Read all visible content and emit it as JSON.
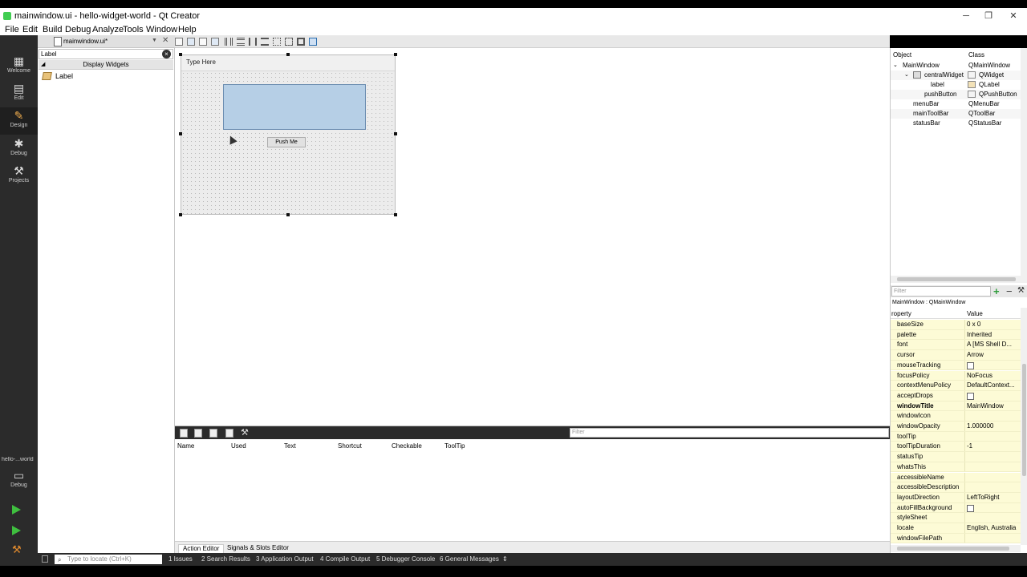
{
  "window": {
    "title": "mainwindow.ui - hello-widget-world - Qt Creator",
    "minimize": "─",
    "maximize": "❐",
    "close": "✕"
  },
  "menu": [
    "File",
    "Edit",
    "Build",
    "Debug",
    "Analyze",
    "Tools",
    "Window",
    "Help"
  ],
  "modes": [
    {
      "label": "Welcome",
      "icon": "grid-icon"
    },
    {
      "label": "Edit",
      "icon": "document-icon"
    },
    {
      "label": "Design",
      "icon": "pencil-icon"
    },
    {
      "label": "Debug",
      "icon": "bug-icon"
    },
    {
      "label": "Projects",
      "icon": "wrench-icon"
    }
  ],
  "kit": {
    "project": "hello-...world",
    "build": "Debug"
  },
  "editor_tab": {
    "name": "mainwindow.ui*",
    "close": "✕"
  },
  "widgetbox": {
    "filter_value": "Label",
    "category": "Display Widgets",
    "item": "Label"
  },
  "form": {
    "menu_placeholder": "Type Here",
    "button_text": "Push Me"
  },
  "object_inspector": {
    "headers": {
      "object": "Object",
      "class": "Class"
    },
    "rows": [
      {
        "name": "MainWindow",
        "class": "QMainWindow"
      },
      {
        "name": "centralWidget",
        "class": "QWidget"
      },
      {
        "name": "label",
        "class": "QLabel"
      },
      {
        "name": "pushButton",
        "class": "QPushButton"
      },
      {
        "name": "menuBar",
        "class": "QMenuBar"
      },
      {
        "name": "mainToolBar",
        "class": "QToolBar"
      },
      {
        "name": "statusBar",
        "class": "QStatusBar"
      }
    ]
  },
  "property_editor": {
    "filter_placeholder": "Filter",
    "class_line": "MainWindow : QMainWindow",
    "headers": {
      "property": "roperty",
      "value": "Value"
    },
    "rows": [
      {
        "k": "baseSize",
        "v": "0 x 0"
      },
      {
        "k": "palette",
        "v": "Inherited"
      },
      {
        "k": "font",
        "v": "A  [MS Shell D..."
      },
      {
        "k": "cursor",
        "v": "Arrow"
      },
      {
        "k": "mouseTracking",
        "check": true
      },
      {
        "k": "focusPolicy",
        "v": "NoFocus"
      },
      {
        "k": "contextMenuPolicy",
        "v": "DefaultContext..."
      },
      {
        "k": "acceptDrops",
        "check": true
      },
      {
        "k": "windowTitle",
        "v": "MainWindow",
        "bold": true
      },
      {
        "k": "windowIcon",
        "v": ""
      },
      {
        "k": "windowOpacity",
        "v": "1.000000"
      },
      {
        "k": "toolTip",
        "v": ""
      },
      {
        "k": "toolTipDuration",
        "v": "-1"
      },
      {
        "k": "statusTip",
        "v": ""
      },
      {
        "k": "whatsThis",
        "v": ""
      },
      {
        "k": "accessibleName",
        "v": ""
      },
      {
        "k": "accessibleDescription",
        "v": ""
      },
      {
        "k": "layoutDirection",
        "v": "LeftToRight"
      },
      {
        "k": "autoFillBackground",
        "check": true
      },
      {
        "k": "styleSheet",
        "v": ""
      },
      {
        "k": "locale",
        "v": "English, Australia"
      },
      {
        "k": "windowFilePath",
        "v": ""
      }
    ]
  },
  "action_editor": {
    "filter_placeholder": "Filter",
    "headers": [
      "Name",
      "Used",
      "Text",
      "Shortcut",
      "Checkable",
      "ToolTip"
    ],
    "tabs": [
      "Action Editor",
      "Signals & Slots Editor"
    ]
  },
  "statusbar": {
    "locate_placeholder": "Type to locate (Ctrl+K)",
    "panes": [
      "1  Issues",
      "2  Search Results",
      "3  Application Output",
      "4  Compile Output",
      "5  Debugger Console",
      "6  General Messages"
    ]
  }
}
